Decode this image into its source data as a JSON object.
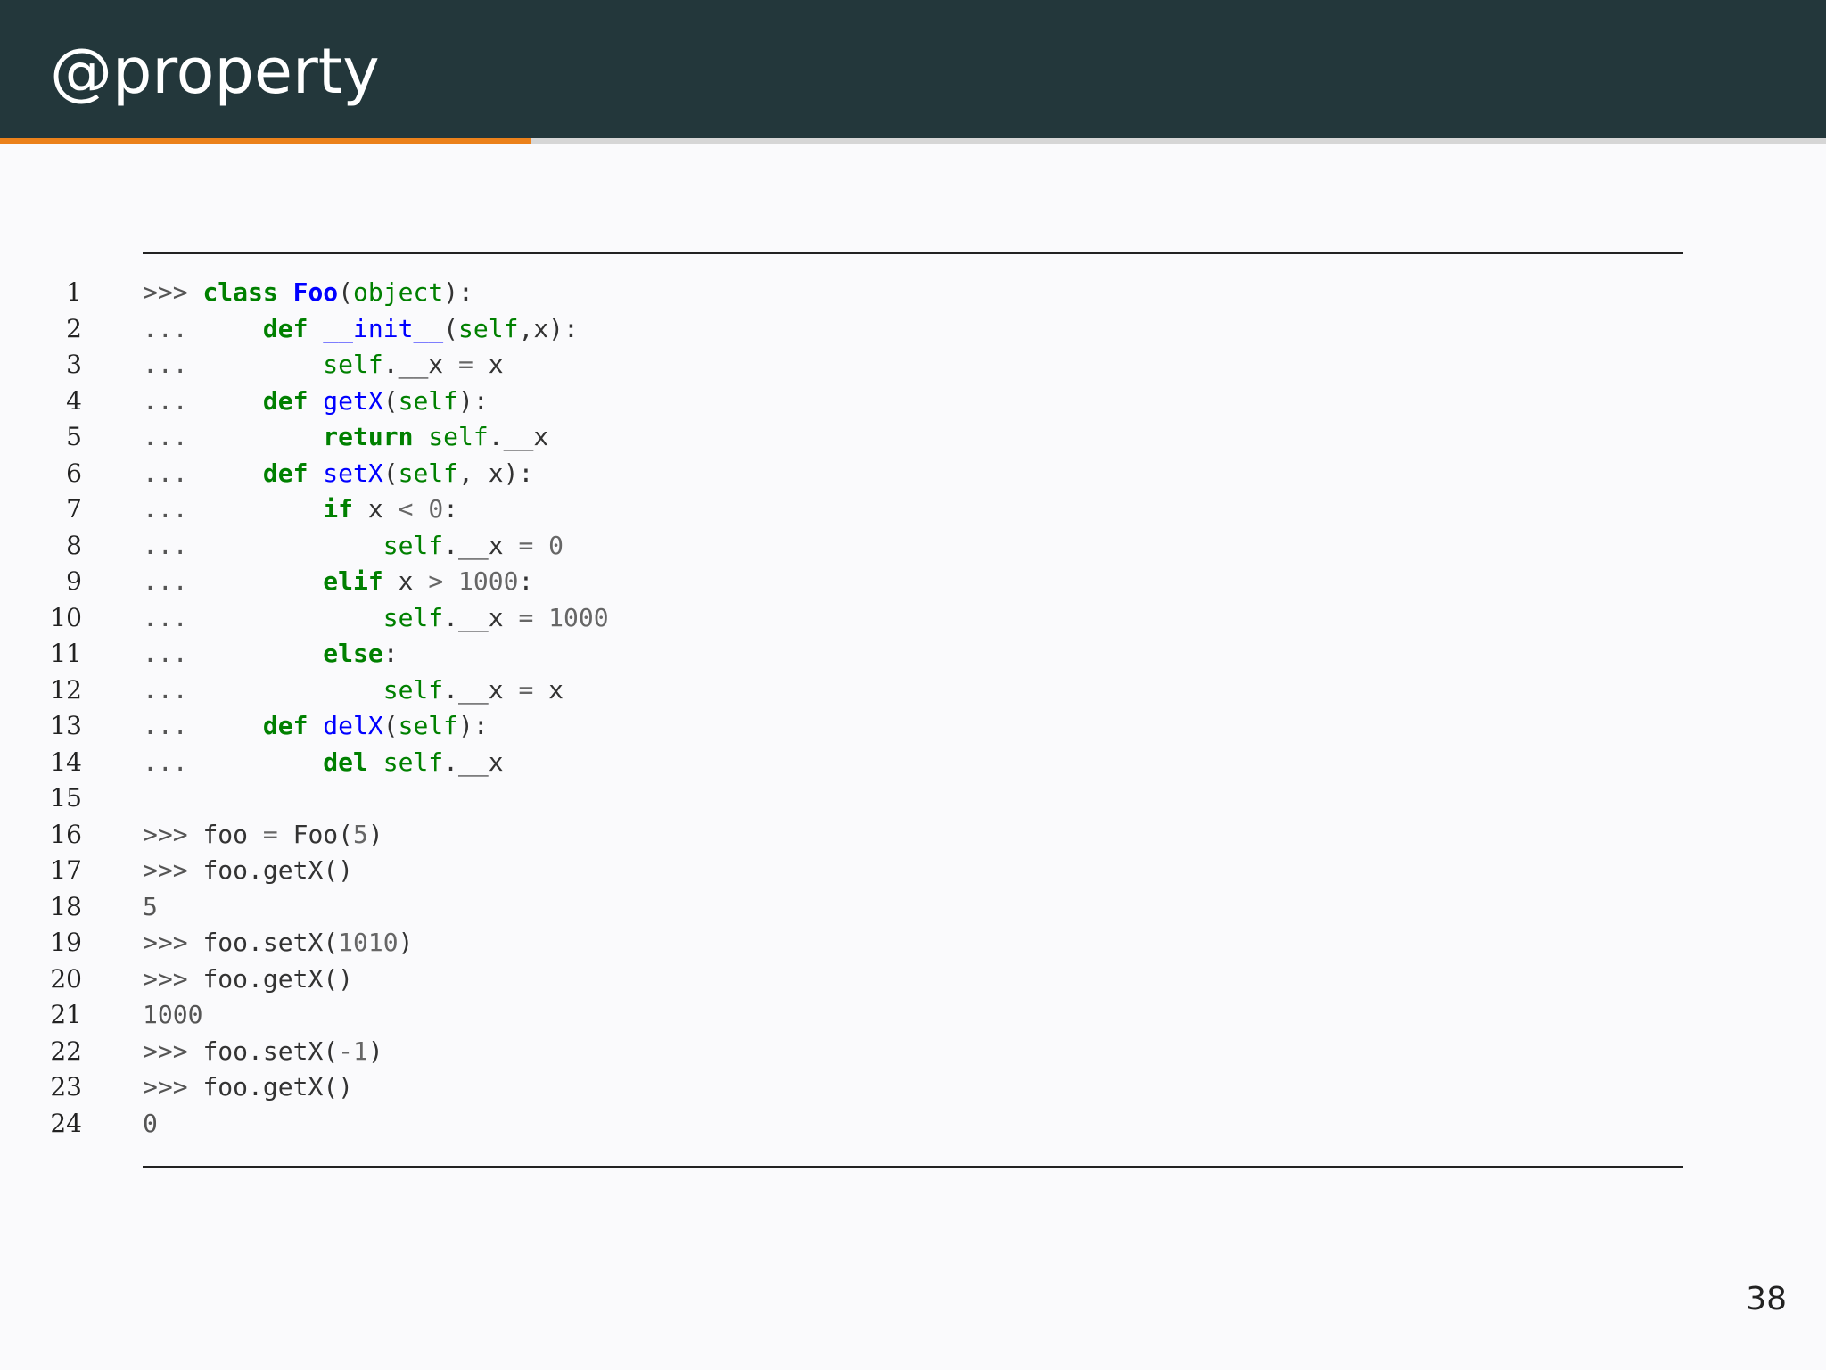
{
  "slide": {
    "title": "@property",
    "page_number": "38",
    "progress_fraction": 0.291
  },
  "code": {
    "lines": [
      {
        "n": "1",
        "tokens": [
          [
            "prompt",
            ">>> "
          ],
          [
            "kw",
            "class"
          ],
          [
            "p",
            " "
          ],
          [
            "nc",
            "Foo"
          ],
          [
            "p",
            "("
          ],
          [
            "bi",
            "object"
          ],
          [
            "p",
            "):"
          ]
        ]
      },
      {
        "n": "2",
        "tokens": [
          [
            "prompt",
            "...     "
          ],
          [
            "kw",
            "def"
          ],
          [
            "p",
            " "
          ],
          [
            "nf",
            "__init__"
          ],
          [
            "p",
            "("
          ],
          [
            "bi",
            "self"
          ],
          [
            "p",
            ","
          ],
          [
            "n",
            "x"
          ],
          [
            "p",
            "):"
          ]
        ]
      },
      {
        "n": "3",
        "tokens": [
          [
            "prompt",
            "...         "
          ],
          [
            "bi",
            "self"
          ],
          [
            "p",
            "."
          ],
          [
            "n",
            "__x"
          ],
          [
            "p",
            " "
          ],
          [
            "op",
            "="
          ],
          [
            "p",
            " "
          ],
          [
            "n",
            "x"
          ]
        ]
      },
      {
        "n": "4",
        "tokens": [
          [
            "prompt",
            "...     "
          ],
          [
            "kw",
            "def"
          ],
          [
            "p",
            " "
          ],
          [
            "nf",
            "getX"
          ],
          [
            "p",
            "("
          ],
          [
            "bi",
            "self"
          ],
          [
            "p",
            "):"
          ]
        ]
      },
      {
        "n": "5",
        "tokens": [
          [
            "prompt",
            "...         "
          ],
          [
            "kw",
            "return"
          ],
          [
            "p",
            " "
          ],
          [
            "bi",
            "self"
          ],
          [
            "p",
            "."
          ],
          [
            "n",
            "__x"
          ]
        ]
      },
      {
        "n": "6",
        "tokens": [
          [
            "prompt",
            "...     "
          ],
          [
            "kw",
            "def"
          ],
          [
            "p",
            " "
          ],
          [
            "nf",
            "setX"
          ],
          [
            "p",
            "("
          ],
          [
            "bi",
            "self"
          ],
          [
            "p",
            ", "
          ],
          [
            "n",
            "x"
          ],
          [
            "p",
            "):"
          ]
        ]
      },
      {
        "n": "7",
        "tokens": [
          [
            "prompt",
            "...         "
          ],
          [
            "kw",
            "if"
          ],
          [
            "p",
            " "
          ],
          [
            "n",
            "x"
          ],
          [
            "p",
            " "
          ],
          [
            "op",
            "<"
          ],
          [
            "p",
            " "
          ],
          [
            "num",
            "0"
          ],
          [
            "p",
            ":"
          ]
        ]
      },
      {
        "n": "8",
        "tokens": [
          [
            "prompt",
            "...             "
          ],
          [
            "bi",
            "self"
          ],
          [
            "p",
            "."
          ],
          [
            "n",
            "__x"
          ],
          [
            "p",
            " "
          ],
          [
            "op",
            "="
          ],
          [
            "p",
            " "
          ],
          [
            "num",
            "0"
          ]
        ]
      },
      {
        "n": "9",
        "tokens": [
          [
            "prompt",
            "...         "
          ],
          [
            "kw",
            "elif"
          ],
          [
            "p",
            " "
          ],
          [
            "n",
            "x"
          ],
          [
            "p",
            " "
          ],
          [
            "op",
            ">"
          ],
          [
            "p",
            " "
          ],
          [
            "num",
            "1000"
          ],
          [
            "p",
            ":"
          ]
        ]
      },
      {
        "n": "10",
        "tokens": [
          [
            "prompt",
            "...             "
          ],
          [
            "bi",
            "self"
          ],
          [
            "p",
            "."
          ],
          [
            "n",
            "__x"
          ],
          [
            "p",
            " "
          ],
          [
            "op",
            "="
          ],
          [
            "p",
            " "
          ],
          [
            "num",
            "1000"
          ]
        ]
      },
      {
        "n": "11",
        "tokens": [
          [
            "prompt",
            "...         "
          ],
          [
            "kw",
            "else"
          ],
          [
            "p",
            ":"
          ]
        ]
      },
      {
        "n": "12",
        "tokens": [
          [
            "prompt",
            "...             "
          ],
          [
            "bi",
            "self"
          ],
          [
            "p",
            "."
          ],
          [
            "n",
            "__x"
          ],
          [
            "p",
            " "
          ],
          [
            "op",
            "="
          ],
          [
            "p",
            " "
          ],
          [
            "n",
            "x"
          ]
        ]
      },
      {
        "n": "13",
        "tokens": [
          [
            "prompt",
            "...     "
          ],
          [
            "kw",
            "def"
          ],
          [
            "p",
            " "
          ],
          [
            "nf",
            "delX"
          ],
          [
            "p",
            "("
          ],
          [
            "bi",
            "self"
          ],
          [
            "p",
            "):"
          ]
        ]
      },
      {
        "n": "14",
        "tokens": [
          [
            "prompt",
            "...         "
          ],
          [
            "kw",
            "del"
          ],
          [
            "p",
            " "
          ],
          [
            "bi",
            "self"
          ],
          [
            "p",
            "."
          ],
          [
            "n",
            "__x"
          ]
        ]
      },
      {
        "n": "15",
        "tokens": []
      },
      {
        "n": "16",
        "tokens": [
          [
            "prompt",
            ">>> "
          ],
          [
            "n",
            "foo"
          ],
          [
            "p",
            " "
          ],
          [
            "op",
            "="
          ],
          [
            "p",
            " "
          ],
          [
            "n",
            "Foo"
          ],
          [
            "p",
            "("
          ],
          [
            "num",
            "5"
          ],
          [
            "p",
            ")"
          ]
        ]
      },
      {
        "n": "17",
        "tokens": [
          [
            "prompt",
            ">>> "
          ],
          [
            "n",
            "foo"
          ],
          [
            "p",
            "."
          ],
          [
            "n",
            "getX"
          ],
          [
            "p",
            "()"
          ]
        ]
      },
      {
        "n": "18",
        "tokens": [
          [
            "out",
            "5"
          ]
        ]
      },
      {
        "n": "19",
        "tokens": [
          [
            "prompt",
            ">>> "
          ],
          [
            "n",
            "foo"
          ],
          [
            "p",
            "."
          ],
          [
            "n",
            "setX"
          ],
          [
            "p",
            "("
          ],
          [
            "num",
            "1010"
          ],
          [
            "p",
            ")"
          ]
        ]
      },
      {
        "n": "20",
        "tokens": [
          [
            "prompt",
            ">>> "
          ],
          [
            "n",
            "foo"
          ],
          [
            "p",
            "."
          ],
          [
            "n",
            "getX"
          ],
          [
            "p",
            "()"
          ]
        ]
      },
      {
        "n": "21",
        "tokens": [
          [
            "out",
            "1000"
          ]
        ]
      },
      {
        "n": "22",
        "tokens": [
          [
            "prompt",
            ">>> "
          ],
          [
            "n",
            "foo"
          ],
          [
            "p",
            "."
          ],
          [
            "n",
            "setX"
          ],
          [
            "p",
            "("
          ],
          [
            "op",
            "-"
          ],
          [
            "num",
            "1"
          ],
          [
            "p",
            ")"
          ]
        ]
      },
      {
        "n": "23",
        "tokens": [
          [
            "prompt",
            ">>> "
          ],
          [
            "n",
            "foo"
          ],
          [
            "p",
            "."
          ],
          [
            "n",
            "getX"
          ],
          [
            "p",
            "()"
          ]
        ]
      },
      {
        "n": "24",
        "tokens": [
          [
            "out",
            "0"
          ]
        ]
      }
    ]
  },
  "colors": {
    "header_bg": "#23373b",
    "accent": "#eb811b",
    "keyword": "#008000",
    "class_name": "#0000ff",
    "function_name": "#0000ff",
    "number": "#666666"
  }
}
